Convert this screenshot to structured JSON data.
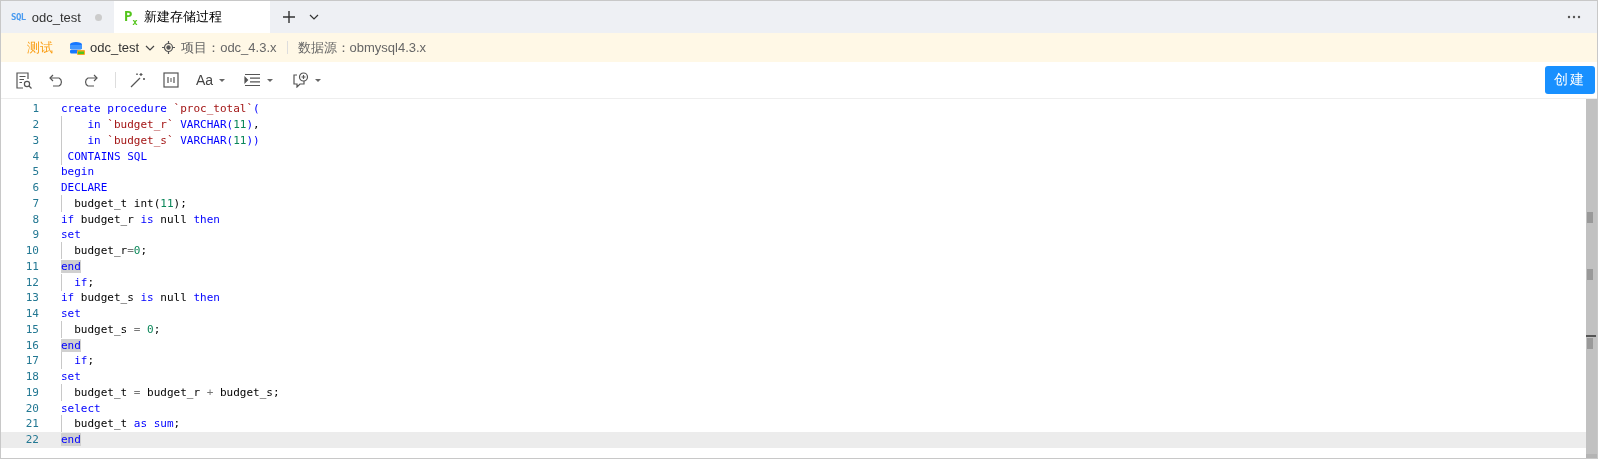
{
  "tabs": [
    {
      "icon_text": "SQL",
      "label": "odc_test",
      "modified": true,
      "selected": false
    },
    {
      "icon_text": "P$_{x}$",
      "label": "新建存储过程",
      "modified": false,
      "selected": true
    }
  ],
  "info_bar": {
    "environment": "测试",
    "database": "odc_test",
    "project": "项目：odc_4.3.x",
    "datasource": "数据源：obmysql4.3.x"
  },
  "toolbar": {
    "font_button": "Aa",
    "create_button": "创建"
  },
  "editor": {
    "lines": [
      {
        "number": "1",
        "guide": false,
        "current": false,
        "tokens": [
          {
            "text": "create procedure ",
            "kind": "kw"
          },
          {
            "text": "`proc_total`",
            "kind": "str"
          },
          {
            "text": "(",
            "kind": "kw"
          }
        ]
      },
      {
        "number": "2",
        "guide": true,
        "current": false,
        "tokens": [
          {
            "text": "    in ",
            "kind": "kw"
          },
          {
            "text": "`budget_r`",
            "kind": "str"
          },
          {
            "text": " VARCHAR(",
            "kind": "kw"
          },
          {
            "text": "11",
            "kind": "num"
          },
          {
            "text": ")",
            "kind": "kw"
          },
          {
            "text": ",",
            "kind": "plain"
          }
        ]
      },
      {
        "number": "3",
        "guide": true,
        "current": false,
        "tokens": [
          {
            "text": "    in ",
            "kind": "kw"
          },
          {
            "text": "`budget_s`",
            "kind": "str"
          },
          {
            "text": " VARCHAR(",
            "kind": "kw"
          },
          {
            "text": "11",
            "kind": "num"
          },
          {
            "text": "))",
            "kind": "kw"
          }
        ]
      },
      {
        "number": "4",
        "guide": true,
        "current": false,
        "tokens": [
          {
            "text": " CONTAINS SQL",
            "kind": "kw"
          }
        ]
      },
      {
        "number": "5",
        "guide": false,
        "current": false,
        "tokens": [
          {
            "text": "begin",
            "kind": "kw"
          }
        ]
      },
      {
        "number": "6",
        "guide": false,
        "current": false,
        "tokens": [
          {
            "text": "DECLARE",
            "kind": "kw"
          }
        ]
      },
      {
        "number": "7",
        "guide": true,
        "current": false,
        "tokens": [
          {
            "text": "  budget_t int(",
            "kind": "plain"
          },
          {
            "text": "11",
            "kind": "num"
          },
          {
            "text": ");",
            "kind": "plain"
          }
        ]
      },
      {
        "number": "8",
        "guide": false,
        "current": false,
        "tokens": [
          {
            "text": "if",
            "kind": "kw"
          },
          {
            "text": " budget_r ",
            "kind": "plain"
          },
          {
            "text": "is",
            "kind": "kw"
          },
          {
            "text": " null ",
            "kind": "plain"
          },
          {
            "text": "then",
            "kind": "kw"
          }
        ]
      },
      {
        "number": "9",
        "guide": false,
        "current": false,
        "tokens": [
          {
            "text": "set",
            "kind": "kw"
          }
        ]
      },
      {
        "number": "10",
        "guide": true,
        "current": false,
        "tokens": [
          {
            "text": "  budget_r",
            "kind": "plain"
          },
          {
            "text": "=",
            "kind": "op"
          },
          {
            "text": "0",
            "kind": "num"
          },
          {
            "text": ";",
            "kind": "plain"
          }
        ]
      },
      {
        "number": "11",
        "guide": false,
        "current": false,
        "tokens": [
          {
            "text": "end",
            "kind": "kw",
            "highlighted": true
          }
        ]
      },
      {
        "number": "12",
        "guide": true,
        "current": false,
        "tokens": [
          {
            "text": "  if",
            "kind": "kw"
          },
          {
            "text": ";",
            "kind": "plain"
          }
        ]
      },
      {
        "number": "13",
        "guide": false,
        "current": false,
        "tokens": [
          {
            "text": "if",
            "kind": "kw"
          },
          {
            "text": " budget_s ",
            "kind": "plain"
          },
          {
            "text": "is",
            "kind": "kw"
          },
          {
            "text": " null ",
            "kind": "plain"
          },
          {
            "text": "then",
            "kind": "kw"
          }
        ]
      },
      {
        "number": "14",
        "guide": false,
        "current": false,
        "tokens": [
          {
            "text": "set",
            "kind": "kw"
          }
        ]
      },
      {
        "number": "15",
        "guide": true,
        "current": false,
        "tokens": [
          {
            "text": "  budget_s ",
            "kind": "plain"
          },
          {
            "text": "= ",
            "kind": "op"
          },
          {
            "text": "0",
            "kind": "num"
          },
          {
            "text": ";",
            "kind": "plain"
          }
        ]
      },
      {
        "number": "16",
        "guide": false,
        "current": false,
        "tokens": [
          {
            "text": "end",
            "kind": "kw",
            "highlighted": true
          }
        ]
      },
      {
        "number": "17",
        "guide": true,
        "current": false,
        "tokens": [
          {
            "text": "  if",
            "kind": "kw"
          },
          {
            "text": ";",
            "kind": "plain"
          }
        ]
      },
      {
        "number": "18",
        "guide": false,
        "current": false,
        "tokens": [
          {
            "text": "set",
            "kind": "kw"
          }
        ]
      },
      {
        "number": "19",
        "guide": true,
        "current": false,
        "tokens": [
          {
            "text": "  budget_t ",
            "kind": "plain"
          },
          {
            "text": "=",
            "kind": "op"
          },
          {
            "text": " budget_r ",
            "kind": "plain"
          },
          {
            "text": "+",
            "kind": "op"
          },
          {
            "text": " budget_s;",
            "kind": "plain"
          }
        ]
      },
      {
        "number": "20",
        "guide": false,
        "current": false,
        "tokens": [
          {
            "text": "select",
            "kind": "kw"
          }
        ]
      },
      {
        "number": "21",
        "guide": true,
        "current": false,
        "tokens": [
          {
            "text": "  budget_t ",
            "kind": "plain"
          },
          {
            "text": "as sum",
            "kind": "kw"
          },
          {
            "text": ";",
            "kind": "plain"
          }
        ]
      },
      {
        "number": "22",
        "guide": false,
        "current": true,
        "tokens": [
          {
            "text": "end",
            "kind": "kw",
            "highlighted": true
          }
        ]
      }
    ]
  }
}
